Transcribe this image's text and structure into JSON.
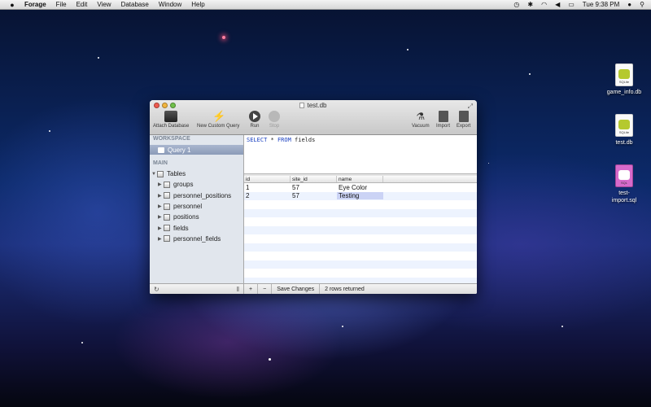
{
  "menubar": {
    "apple_icon": "apple-icon",
    "app_name": "Forage",
    "menus": [
      "File",
      "Edit",
      "View",
      "Database",
      "Window",
      "Help"
    ],
    "clock": "Tue 9:38 PM",
    "status_icons": [
      "time-machine-icon",
      "bluetooth-icon",
      "wifi-icon",
      "volume-icon",
      "battery-icon",
      "user-icon",
      "spotlight-icon"
    ]
  },
  "desktop_icons": [
    {
      "label": "game_info.db",
      "type": "SQLite"
    },
    {
      "label": "test.db",
      "type": "SQLite"
    },
    {
      "label": "test-\nimport.sql",
      "type": "SQL"
    }
  ],
  "window": {
    "title": "test.db",
    "toolbar": {
      "attach": "Attach Database",
      "custom": "New Custom Query",
      "run": "Run",
      "stop": "Stop",
      "vacuum": "Vacuum",
      "import": "Import",
      "export": "Export"
    },
    "sidebar": {
      "workspace_label": "WORKSPACE",
      "query_item": "Query 1",
      "main_label": "MAIN",
      "tables_label": "Tables",
      "tables": [
        "groups",
        "personnel_positions",
        "personnel",
        "positions",
        "fields",
        "personnel_fields"
      ]
    },
    "editor": {
      "kw_select": "SELECT",
      "star": "*",
      "kw_from": "FROM",
      "table": "fields"
    },
    "grid": {
      "columns": [
        "id",
        "site_id",
        "name"
      ],
      "rows": [
        [
          "1",
          "57",
          "Eye Color"
        ],
        [
          "2",
          "57",
          "Testing"
        ]
      ]
    },
    "footer": {
      "add": "+",
      "remove": "−",
      "save": "Save Changes",
      "status": "2 rows returned"
    }
  }
}
